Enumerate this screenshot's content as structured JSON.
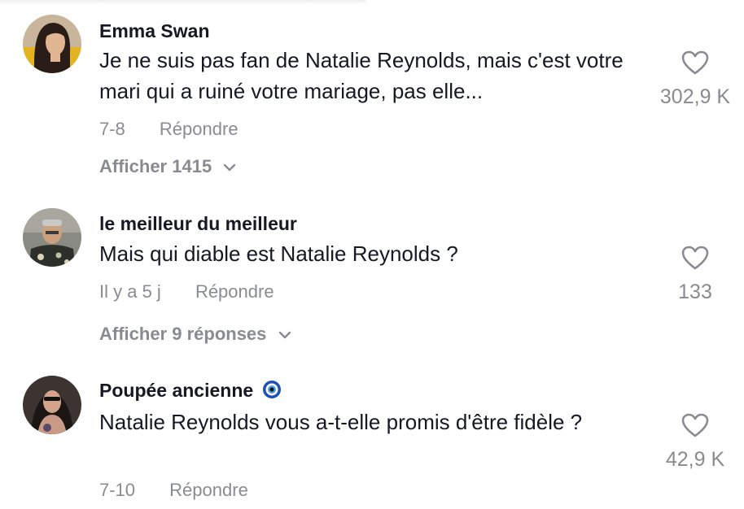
{
  "comments": [
    {
      "author": "Emma Swan",
      "text": "Je ne suis pas fan de Natalie Reynolds, mais c'est votre mari qui a ruiné votre mariage, pas elle...",
      "date": "7-8",
      "reply_label": "Répondre",
      "likes": "302,9 K",
      "show_replies_label": "Afficher 1415"
    },
    {
      "author": "le meilleur du meilleur",
      "text": "Mais qui diable est Natalie Reynolds ?",
      "date": "Il y a 5 j",
      "reply_label": "Répondre",
      "likes": "133",
      "show_replies_label": "Afficher 9 réponses"
    },
    {
      "author": "Poupée ancienne",
      "badge_icon": "nazar-eye-emoji",
      "text": "Natalie Reynolds vous a-t-elle promis d'être fidèle ?",
      "date": "7-10",
      "reply_label": "Répondre",
      "likes": "42,9 K"
    }
  ],
  "icons": {
    "like": "heart-outline-icon",
    "expand": "chevron-down-icon"
  },
  "colors": {
    "primary_text": "#161823",
    "secondary_text": "#8a8b91",
    "background": "#ffffff"
  }
}
